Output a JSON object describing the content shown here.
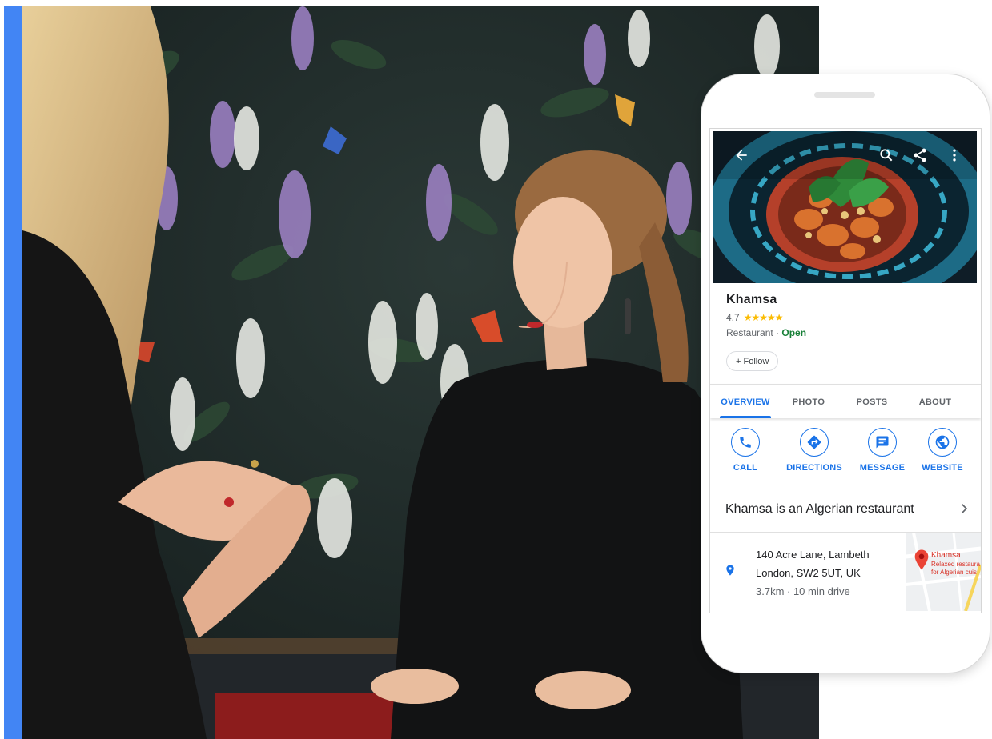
{
  "colors": {
    "accent_blue": "#4285f4",
    "link_blue": "#1a73e8",
    "open_green": "#188038",
    "star_yellow": "#fbbc04"
  },
  "hero": {
    "icons": [
      "back-arrow-icon",
      "search-icon",
      "share-icon",
      "more-vert-icon"
    ]
  },
  "place": {
    "name": "Khamsa",
    "rating": "4.7",
    "stars": "★★★★★",
    "category": "Restaurant",
    "separator": "·",
    "status": "Open",
    "follow_label": "+ Follow"
  },
  "tabs": [
    {
      "label": "OVERVIEW",
      "active": true
    },
    {
      "label": "PHOTO",
      "active": false
    },
    {
      "label": "POSTS",
      "active": false
    },
    {
      "label": "ABOUT",
      "active": false
    }
  ],
  "actions": [
    {
      "label": "CALL",
      "icon": "phone-icon"
    },
    {
      "label": "DIRECTIONS",
      "icon": "directions-icon"
    },
    {
      "label": "MESSAGE",
      "icon": "message-icon"
    },
    {
      "label": "WEBSITE",
      "icon": "globe-icon"
    }
  ],
  "description": "Khamsa is an Algerian restaurant",
  "address": {
    "line1": "140 Acre Lane, Lambeth",
    "line2": "London, SW2 5UT, UK",
    "distance": "3.7km · 10 min drive"
  },
  "map": {
    "pin_label": "Khamsa",
    "sub1": "Relaxed restaura",
    "sub2": "for Algerian cuis"
  }
}
